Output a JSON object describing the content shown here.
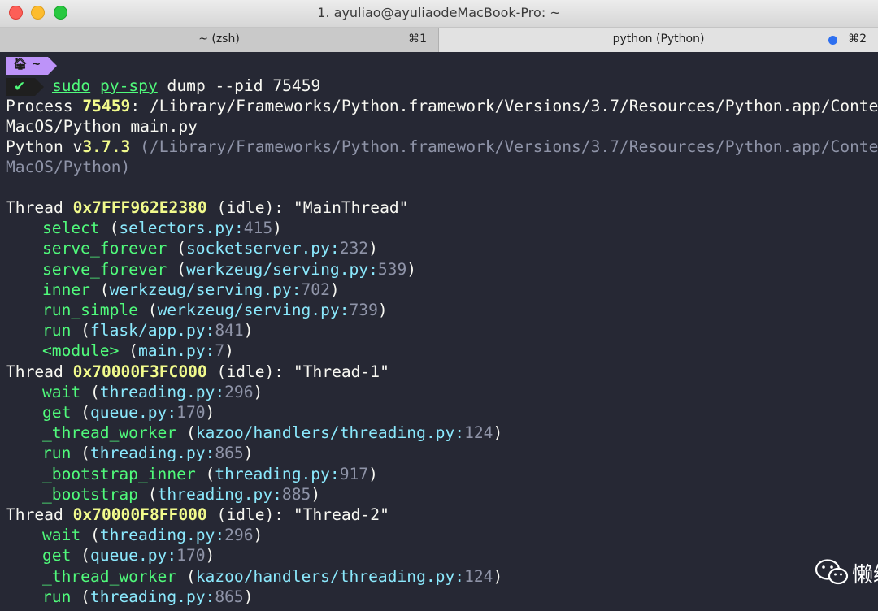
{
  "window": {
    "title": "1. ayuliao@ayuliaodeMacBook-Pro: ~",
    "tabs": [
      {
        "label": "~ (zsh)",
        "shortcut": "⌘1"
      },
      {
        "label": "python (Python)",
        "shortcut": "⌘2"
      }
    ]
  },
  "prompt": {
    "context": "🏠︎ ~",
    "status_icon": "check-icon",
    "status_glyph": "✔",
    "cmd_sudo": "sudo",
    "cmd_pyspy": "py-spy",
    "cmd_args": " dump --pid 75459"
  },
  "output": {
    "process_label": "Process ",
    "pid": "75459",
    "process_path1": ": /Library/Frameworks/Python.framework/Versions/3.7/Resources/Python.app/Contents/",
    "process_path2": "MacOS/Python main.py",
    "python_label": "Python v",
    "python_version": "3.7.3",
    "python_path1": " (/Library/Frameworks/Python.framework/Versions/3.7/Resources/Python.app/Contents/",
    "python_path2": "MacOS/Python)"
  },
  "threads": [
    {
      "label": "Thread ",
      "id": "0x7FFF962E2380",
      "status": " (idle): \"MainThread\"",
      "frames": [
        {
          "func": "select",
          "file": "selectors.py",
          "line": "415"
        },
        {
          "func": "serve_forever",
          "file": "socketserver.py",
          "line": "232"
        },
        {
          "func": "serve_forever",
          "file": "werkzeug/serving.py",
          "line": "539"
        },
        {
          "func": "inner",
          "file": "werkzeug/serving.py",
          "line": "702"
        },
        {
          "func": "run_simple",
          "file": "werkzeug/serving.py",
          "line": "739"
        },
        {
          "func": "run",
          "file": "flask/app.py",
          "line": "841"
        },
        {
          "func": "<module>",
          "file": "main.py",
          "line": "7"
        }
      ]
    },
    {
      "label": "Thread ",
      "id": "0x70000F3FC000",
      "status": " (idle): \"Thread-1\"",
      "frames": [
        {
          "func": "wait",
          "file": "threading.py",
          "line": "296"
        },
        {
          "func": "get",
          "file": "queue.py",
          "line": "170"
        },
        {
          "func": "_thread_worker",
          "file": "kazoo/handlers/threading.py",
          "line": "124"
        },
        {
          "func": "run",
          "file": "threading.py",
          "line": "865"
        },
        {
          "func": "_bootstrap_inner",
          "file": "threading.py",
          "line": "917"
        },
        {
          "func": "_bootstrap",
          "file": "threading.py",
          "line": "885"
        }
      ]
    },
    {
      "label": "Thread ",
      "id": "0x70000F8FF000",
      "status": " (idle): \"Thread-2\"",
      "frames": [
        {
          "func": "wait",
          "file": "threading.py",
          "line": "296"
        },
        {
          "func": "get",
          "file": "queue.py",
          "line": "170"
        },
        {
          "func": "_thread_worker",
          "file": "kazoo/handlers/threading.py",
          "line": "124"
        },
        {
          "func": "run",
          "file": "threading.py",
          "line": "865"
        }
      ]
    }
  ],
  "watermark": {
    "text": "懒编程",
    "icon": "wechat-icon"
  },
  "colors": {
    "background": "#262834",
    "function": "#50fa7b",
    "file": "#8be9fd",
    "line_number": "#8f94a8",
    "highlight": "#f1fa8c",
    "prompt_segment": "#bd93f9"
  }
}
